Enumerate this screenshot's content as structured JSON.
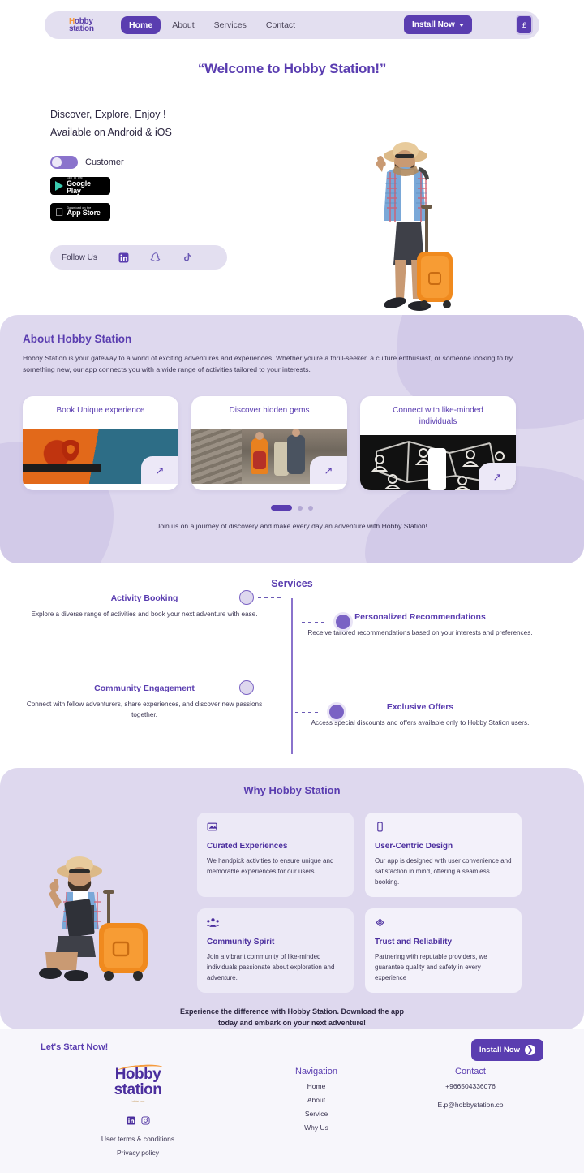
{
  "theme": {
    "primary": "#5a3db0",
    "accent_orange": "#f59a3c",
    "lavender": "#ded8ee",
    "pale": "#e3dff0"
  },
  "header": {
    "brand_line1": "Hobby",
    "brand_line1_first": "H",
    "brand_line1_rest": "obby",
    "brand_line2": "station",
    "nav": [
      {
        "label": "Home",
        "active": true
      },
      {
        "label": "About",
        "active": false
      },
      {
        "label": "Services",
        "active": false
      },
      {
        "label": "Contact",
        "active": false
      }
    ],
    "install_label": "Install Now",
    "currency_label": "£"
  },
  "hero": {
    "title": "“Welcome to Hobby Station!”",
    "tagline_1": "Discover, Explore, Enjoy !",
    "tagline_2": "Available on Android & iOS",
    "toggle_label": "Customer",
    "google_play_small": "GET IT ON",
    "google_play_big": "Google Play",
    "app_store_small": "Download on the",
    "app_store_big": "App Store",
    "follow_label": "Follow Us",
    "socials": [
      "linkedin-icon",
      "snapchat-icon",
      "tiktok-icon"
    ],
    "image_alt": "traveler-pointing-with-suitcase"
  },
  "about": {
    "heading": "About Hobby Station",
    "paragraph": "Hobby Station is your gateway to a world of exciting adventures and experiences. Whether you're a thrill-seeker, a culture enthusiast, or someone looking to try something new, our app connects you with a wide range of activities tailored to your interests.",
    "cards": [
      {
        "title": "Book Unique experience",
        "image": "hot-air-balloon",
        "arrow": "↗"
      },
      {
        "title": "Discover hidden gems",
        "image": "hikers-on-great-wall",
        "arrow": "↗"
      },
      {
        "title": "Connect with like-minded individuals",
        "image": "social-network-phone",
        "arrow": "↗"
      }
    ],
    "carousel_dots": 3,
    "carousel_active": 0,
    "footer_text": "Join us on a journey of discovery and make every day an adventure with Hobby Station!"
  },
  "services": {
    "title": "Services",
    "items": [
      {
        "title": "Activity Booking",
        "desc": "Explore a diverse range of activities and book your next adventure with ease.",
        "side": "left"
      },
      {
        "title": "Personalized Recommendations",
        "desc": "Receive tailored recommendations based on your interests and preferences.",
        "side": "right"
      },
      {
        "title": "Community Engagement",
        "desc": "Connect with fellow adventurers, share experiences, and discover new passions together.",
        "side": "left"
      },
      {
        "title": "Exclusive Offers",
        "desc": "Access special discounts and offers available only to Hobby Station users.",
        "side": "right"
      }
    ]
  },
  "why": {
    "title": "Why Hobby Station",
    "image_alt": "seated-traveler-thumbs-up-with-suitcase",
    "cards": [
      {
        "icon": "image-icon",
        "title": "Curated Experiences",
        "desc": "We handpick activities to ensure unique and memorable experiences for our users."
      },
      {
        "icon": "mobile-phone-icon",
        "title": "User-Centric Design",
        "desc": "Our app is designed with user convenience and satisfaction in mind, offering a seamless booking."
      },
      {
        "icon": "community-people-icon",
        "title": "Community Spirit",
        "desc": "Join a vibrant community of like-minded individuals passionate about exploration and adventure."
      },
      {
        "icon": "badge-ribbon-icon",
        "title": "Trust and Reliability",
        "desc": "Partnering with reputable providers, we guarantee quality and safety in every experience"
      }
    ],
    "footer_line1": "Experience the difference with Hobby Station. Download the app",
    "footer_line2": "today and embark on your next adventure!"
  },
  "footer": {
    "start_now": "Let's Start Now!",
    "install_label": "Install Now",
    "logo_line1": "Hobby",
    "logo_line2": "station",
    "logo_sub": "هوبي ستيشن",
    "socials": [
      "linkedin-icon",
      "instagram-icon"
    ],
    "terms": "User terms & conditions",
    "privacy": "Privacy policy",
    "nav_heading": "Navigation",
    "nav_items": [
      "Home",
      "About",
      "Service",
      "Why Us"
    ],
    "contact_heading": "Contact",
    "contact_phone": "+966504336076",
    "contact_email": "E.p@hobbystation.co"
  }
}
